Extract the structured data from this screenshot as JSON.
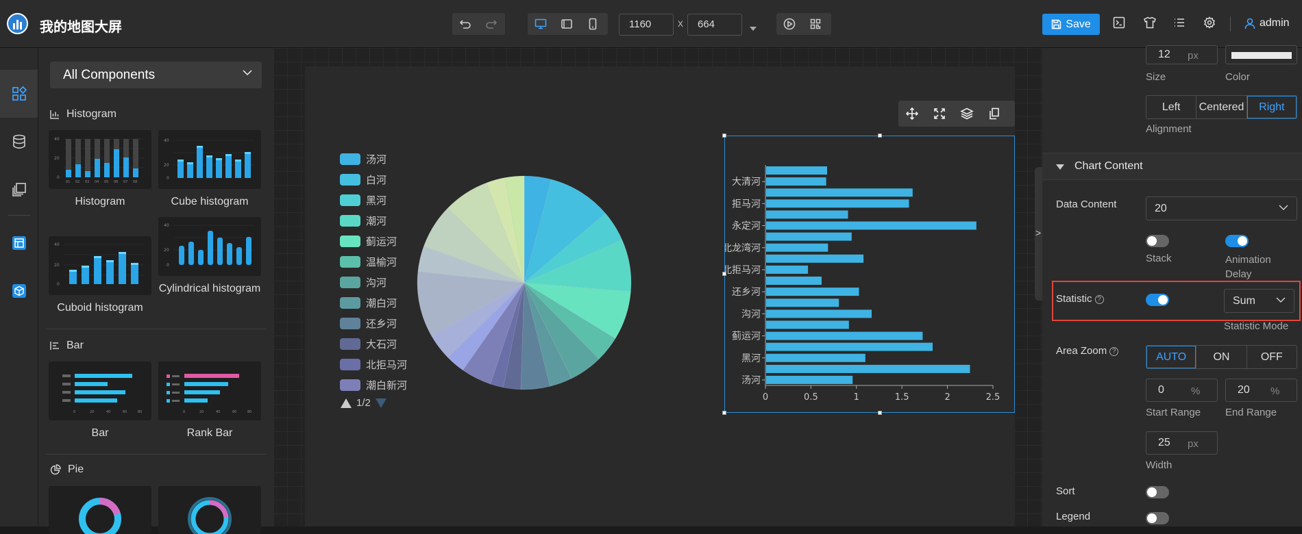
{
  "app": {
    "title": "我的地图大屏",
    "user": "admin",
    "save_label": "Save"
  },
  "toolbar": {
    "width": "1160",
    "height": "664",
    "times": "x"
  },
  "components": {
    "category": "All Components",
    "sections": [
      {
        "title": "Histogram",
        "items": [
          "Histogram",
          "Cube histogram",
          "Cuboid histogram",
          "Cylindrical histogram"
        ]
      },
      {
        "title": "Bar",
        "items": [
          "Bar",
          "Rank Bar"
        ]
      },
      {
        "title": "Pie"
      }
    ]
  },
  "pie_legend": {
    "items": [
      "汤河",
      "白河",
      "黑河",
      "潮河",
      "蓟运河",
      "温榆河",
      "沟河",
      "潮白河",
      "还乡河",
      "大石河",
      "北拒马河",
      "潮白新河"
    ],
    "colors": [
      "#3fb3e3",
      "#45bfe0",
      "#4fcfd3",
      "#5ad8c6",
      "#67e3c0",
      "#5bbfaa",
      "#5ba5a0",
      "#5d9aa0",
      "#5f829a",
      "#606a95",
      "#6a6fa8",
      "#7d80b6"
    ],
    "page": "1/2"
  },
  "chart_data": [
    {
      "type": "pie",
      "slices": [
        {
          "name": "汤河",
          "value": 0.95,
          "color": "#3fb3e3"
        },
        {
          "name": "白河",
          "value": 2.24,
          "color": "#45bfe0"
        },
        {
          "name": "黑河",
          "value": 1.09,
          "color": "#4fcfd3"
        },
        {
          "name": "潮河",
          "value": 1.83,
          "color": "#5ad8c6"
        },
        {
          "name": "蓟运河",
          "value": 1.72,
          "color": "#67e3c0"
        },
        {
          "name": "温榆河",
          "value": 0.91,
          "color": "#5bbfaa"
        },
        {
          "name": "沟河",
          "value": 1.16,
          "color": "#5ba5a0"
        },
        {
          "name": "潮白河",
          "value": 0.8,
          "color": "#5d9aa0"
        },
        {
          "name": "还乡河",
          "value": 1.02,
          "color": "#5f829a"
        },
        {
          "name": "大石河",
          "value": 0.61,
          "color": "#606a95"
        },
        {
          "name": "北拒马河",
          "value": 0.46,
          "color": "#6a6fa8"
        },
        {
          "name": "潮白新河",
          "value": 1.07,
          "color": "#7d80b6"
        },
        {
          "value": 0.68,
          "color": "#9aa5e6"
        },
        {
          "value": 0.94,
          "color": "#a7b0d8"
        },
        {
          "value": 2.31,
          "color": "#aab4c8"
        },
        {
          "value": 0.9,
          "color": "#b5c4cc"
        },
        {
          "value": 1.57,
          "color": "#bfd2bf"
        },
        {
          "value": 1.61,
          "color": "#c8dcb5"
        },
        {
          "value": 0.66,
          "color": "#d2e6ae"
        },
        {
          "value": 0.67,
          "color": "#c9e7a6"
        }
      ]
    },
    {
      "type": "bar",
      "orientation": "horizontal",
      "category_labels": [
        "汤河",
        "黑河",
        "蓟运河",
        "沟河",
        "还乡河",
        "北拒马河",
        "北龙湾河",
        "永定河",
        "拒马河",
        "大清河"
      ],
      "values": [
        0.95,
        2.24,
        1.09,
        1.83,
        1.72,
        0.91,
        1.16,
        0.8,
        1.02,
        0.61,
        0.46,
        1.07,
        0.68,
        0.94,
        2.31,
        0.9,
        1.57,
        1.61,
        0.66,
        0.67
      ],
      "xticks": [
        "0",
        "0.5",
        "1",
        "1.5",
        "2",
        "2.5"
      ],
      "xlim": [
        0,
        2.5
      ],
      "color": "#3fb3e3"
    }
  ],
  "props": {
    "size_value": "12",
    "size_unit": "px",
    "size_label": "Size",
    "color_label": "Color",
    "align": [
      "Left",
      "Centered",
      "Right"
    ],
    "align_label": "Alignment",
    "chart_content": "Chart Content",
    "data_content_label": "Data Content",
    "data_content_value": "20",
    "stack_label": "Stack",
    "anim_label": "Animation Delay",
    "statistic_label": "Statistic",
    "stat_value": "Sum",
    "stat_mode_label": "Statistic Mode",
    "area_zoom_label": "Area Zoom",
    "zoom_opts": [
      "AUTO",
      "ON",
      "OFF"
    ],
    "start_value": "0",
    "end_value": "20",
    "pct": "%",
    "start_label": "Start Range",
    "end_label": "End Range",
    "width_value": "25",
    "width_unit": "px",
    "width_label": "Width",
    "sort_label": "Sort",
    "legend_label": "Legend",
    "collapse": ">"
  }
}
